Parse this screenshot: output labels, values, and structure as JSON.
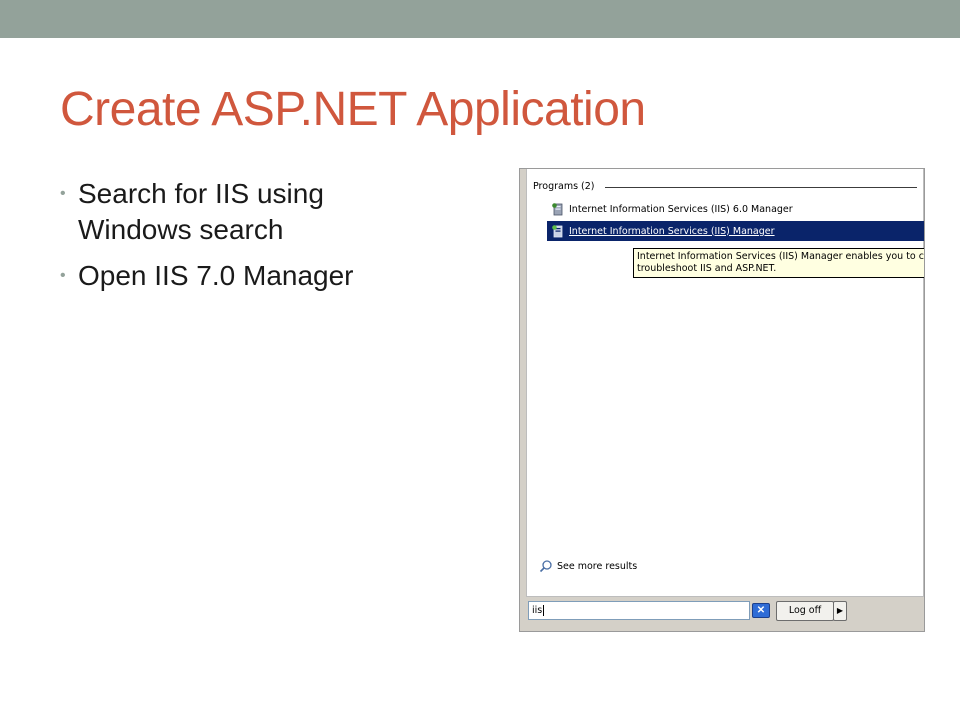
{
  "slide": {
    "title": "Create ASP.NET Application",
    "bullets": [
      "Search for IIS using Windows search",
      "Open IIS 7.0 Manager"
    ]
  },
  "start_menu": {
    "section_header": "Programs (2)",
    "programs": [
      {
        "label": "Internet Information Services (IIS) 6.0 Manager",
        "icon": "iis-icon",
        "selected": false
      },
      {
        "label": "Internet Information Services (IIS) Manager",
        "icon": "iis-icon",
        "selected": true
      }
    ],
    "tooltip_lines": [
      "Internet Information Services (IIS) Manager enables you to co",
      "troubleshoot IIS and ASP.NET."
    ],
    "see_more": "See more results",
    "search_value": "iis",
    "clear_icon": "clear-x-icon",
    "logoff_label": "Log off",
    "arrow_icon": "right-arrow-icon"
  },
  "colors": {
    "title": "#d0573d",
    "top_bar": "#93a29a",
    "selection": "#0a246a",
    "tooltip_bg": "#ffffe1"
  }
}
